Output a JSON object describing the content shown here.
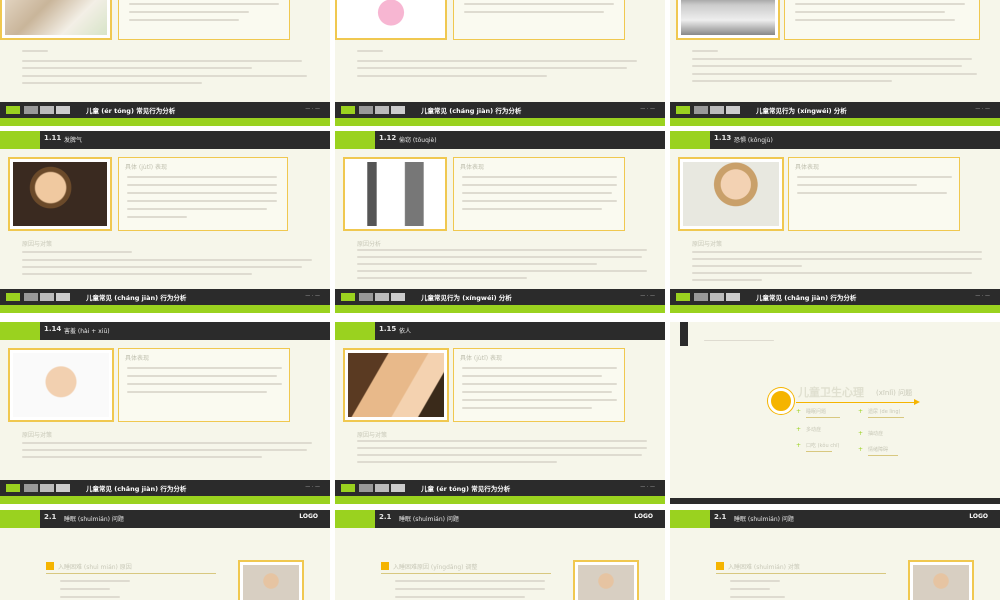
{
  "slides": {
    "r0c0": {
      "footer_title": "儿童 (ér tóng) 常见行为分析"
    },
    "r0c1": {
      "footer_title": "儿童常见 (cháng jiàn) 行为分析"
    },
    "r0c2": {
      "footer_title": "儿童常见行为 (xíngwéi) 分析"
    },
    "r1c0": {
      "num": "1.11",
      "title": "发脾气",
      "box_title": "具体 (jùtǐ) 表现",
      "section": "原因与对策",
      "footer_title": "儿童常见 (cháng jiàn) 行为分析"
    },
    "r1c1": {
      "num": "1.12",
      "title": "偷窃 (tōuqiè)",
      "box_title": "具体表现",
      "section": "原因分析",
      "footer_title": "儿童常见行为 (xíngwéi) 分析"
    },
    "r1c2": {
      "num": "1.13",
      "title": "恐惧 (kǒngjù)",
      "box_title": "具体表现",
      "section": "原因与对策",
      "footer_title": "儿童常见 (chǎng jiàn) 行为分析"
    },
    "r2c0": {
      "num": "1.14",
      "title": "害羞 (hài + xiū)",
      "box_title": "具体表现",
      "section": "原因与对策",
      "footer_title": "儿童常见 (chǎng jiàn) 行为分析"
    },
    "r2c1": {
      "num": "1.15",
      "title": "依人",
      "box_title": "具体 (jùtǐ) 表现",
      "section": "原因与对策",
      "footer_title": "儿童 (ér tóng) 常见行为分析"
    },
    "r2c2": {
      "heading": "儿童卫生心理",
      "heading_suffix": "(xīnlǐ) 问题",
      "items_left": [
        "睡眠问题",
        "多动症",
        "口吃 (kǒu chī)"
      ],
      "items_right": [
        "遗尿 (de lìng)",
        "抽动症",
        "情绪障碍"
      ]
    },
    "r3c0": {
      "num": "2.1",
      "title": "睡眠 (shuìmián) 问题",
      "logo": "LOGO",
      "box_title": "入睡困难 (shuì mián) 原因"
    },
    "r3c1": {
      "num": "2.1",
      "title": "睡眠 (shuìmián) 问题",
      "logo": "LOGO",
      "box_title": "入睡困难原因 (yīngdāng) 调整"
    },
    "r3c2": {
      "num": "2.1",
      "title": "睡眠 (shuìmián) 问题",
      "logo": "LOGO",
      "box_title": "入睡困难 (shuìmián) 对策"
    }
  },
  "colors": {
    "green": "#9ad21f",
    "dark": "#2b2b2b",
    "gold": "#f5b400",
    "bg": "#f6f6ea"
  }
}
